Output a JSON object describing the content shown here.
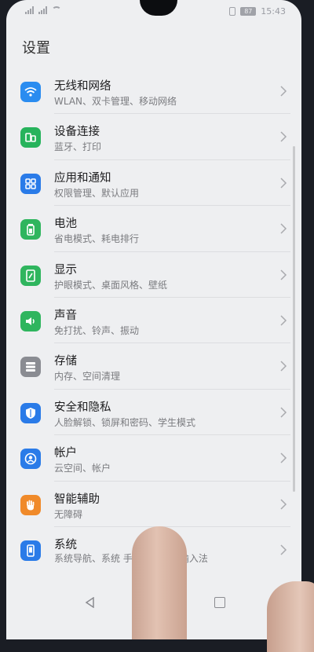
{
  "status_bar": {
    "time": "15:43",
    "battery": "87"
  },
  "page": {
    "title": "设置"
  },
  "items": [
    {
      "title": "无线和网络",
      "subtitle": "WLAN、双卡管理、移动网络",
      "icon": "wifi-icon",
      "color": "#2a8cf0"
    },
    {
      "title": "设备连接",
      "subtitle": "蓝牙、打印",
      "icon": "device-connect-icon",
      "color": "#27b35c"
    },
    {
      "title": "应用和通知",
      "subtitle": "权限管理、默认应用",
      "icon": "apps-icon",
      "color": "#2a7be8"
    },
    {
      "title": "电池",
      "subtitle": "省电模式、耗电排行",
      "icon": "battery-icon",
      "color": "#2fb55e"
    },
    {
      "title": "显示",
      "subtitle": "护眼模式、桌面风格、壁纸",
      "icon": "display-icon",
      "color": "#2fb55e"
    },
    {
      "title": "声音",
      "subtitle": "免打扰、铃声、振动",
      "icon": "sound-icon",
      "color": "#2fb55e"
    },
    {
      "title": "存储",
      "subtitle": "内存、空间清理",
      "icon": "storage-icon",
      "color": "#8a8c92"
    },
    {
      "title": "安全和隐私",
      "subtitle": "人脸解锁、锁屏和密码、学生模式",
      "icon": "shield-icon",
      "color": "#2a7be8"
    },
    {
      "title": "帐户",
      "subtitle": "云空间、帐户",
      "icon": "account-icon",
      "color": "#2a7be8"
    },
    {
      "title": "智能辅助",
      "subtitle": "无障碍",
      "icon": "hand-icon",
      "color": "#f08a2a"
    },
    {
      "title": "系统",
      "subtitle": "系统导航、系统    手机、语言和输入法",
      "icon": "phone-icon",
      "color": "#2a7be8"
    }
  ]
}
